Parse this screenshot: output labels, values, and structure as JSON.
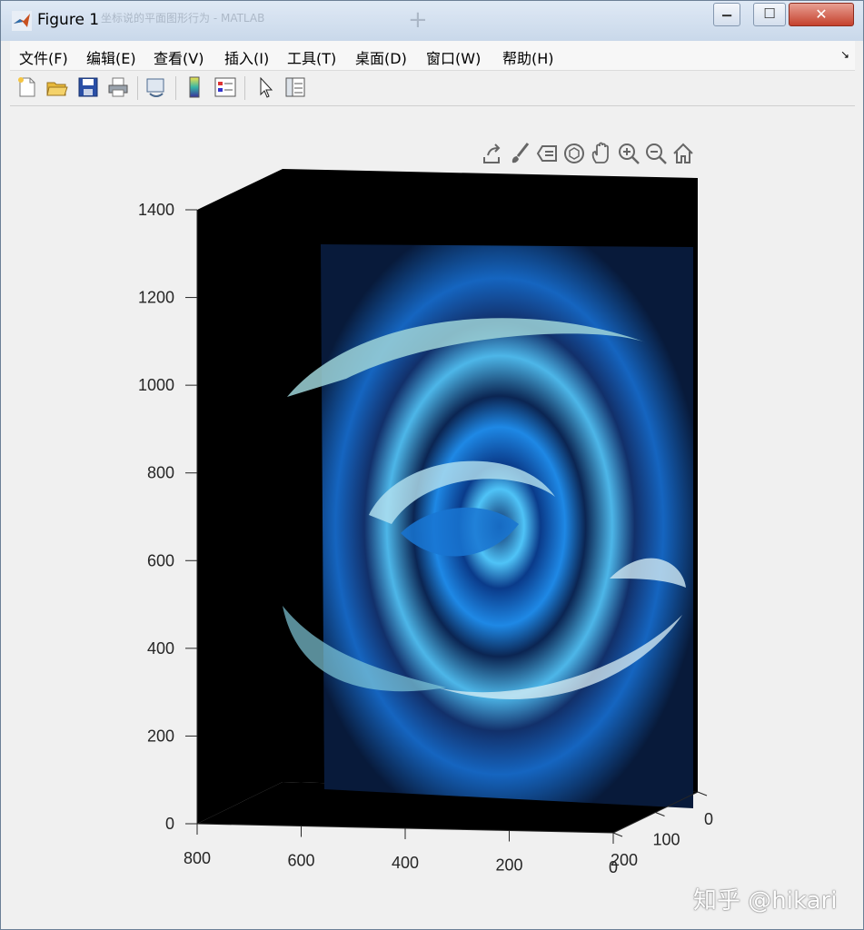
{
  "window": {
    "title": "Figure 1",
    "background_tab_text": "坐标说的平面图形行为 - MATLAB",
    "background_tab_plus": "+",
    "minimize_glyph": "▁",
    "maximize_glyph": "☐",
    "close_glyph": "✕"
  },
  "menu": {
    "items": [
      "文件(F)",
      "编辑(E)",
      "查看(V)",
      "插入(I)",
      "工具(T)",
      "桌面(D)",
      "窗口(W)",
      "帮助(H)"
    ],
    "overflow_arrow": "↘"
  },
  "toolbar": {
    "buttons": [
      "new-figure",
      "open-file",
      "save",
      "print",
      "link-plot",
      "insert-colorbar",
      "insert-legend",
      "edit-plot-pointer",
      "property-inspector"
    ]
  },
  "axes_toolbar": {
    "buttons": [
      "export-icon",
      "brush-icon",
      "data-tips-icon",
      "rotate-3d-icon",
      "pan-icon",
      "zoom-in-icon",
      "zoom-out-icon",
      "home-icon"
    ]
  },
  "chart_data": {
    "type": "surface",
    "title": "",
    "colormap": "blue-cyan swirl image rendered as 3-D surface on black background",
    "z_axis": {
      "ticks": [
        0,
        200,
        400,
        600,
        800,
        1000,
        1200,
        1400
      ],
      "lim": [
        0,
        1400
      ]
    },
    "x_axis": {
      "ticks": [
        800,
        600,
        400,
        200,
        0
      ],
      "lim": [
        0,
        800
      ],
      "direction": "reverse"
    },
    "y_axis": {
      "ticks": [
        200,
        100,
        0
      ],
      "lim": [
        0,
        200
      ]
    },
    "grid": true,
    "axes_color": "#000000"
  },
  "watermark": "知乎 @hikari"
}
